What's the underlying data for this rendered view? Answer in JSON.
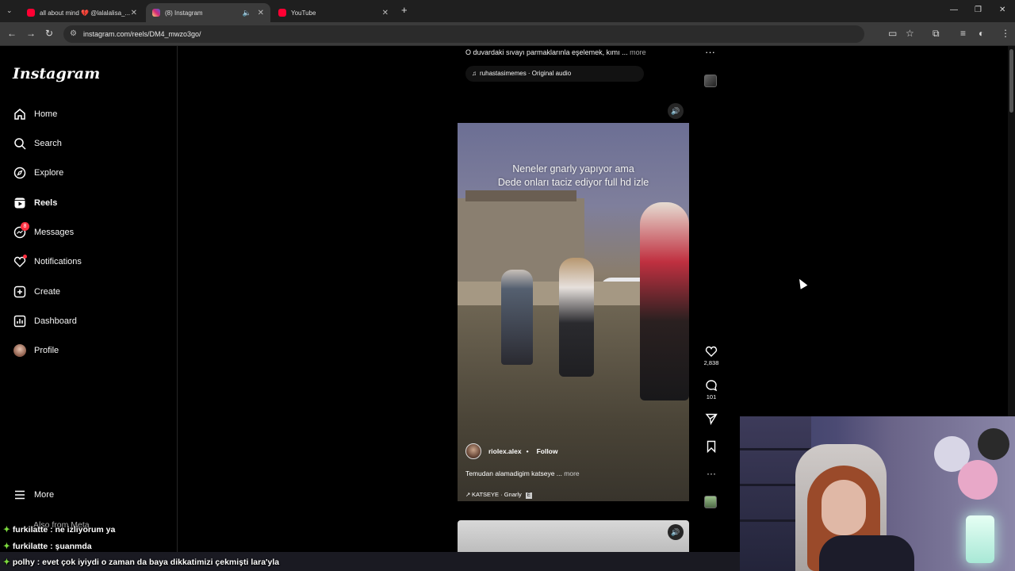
{
  "browser": {
    "tabs": [
      {
        "label": "all about mind 💔 @lalalalisa_...",
        "active": false,
        "favicon_color": "#ff0033"
      },
      {
        "label": "(8) Instagram",
        "active": true,
        "favicon_color": "#d62976"
      },
      {
        "label": "YouTube",
        "active": false,
        "favicon_color": "#ff0033"
      }
    ],
    "new_tab": "+",
    "url": "instagram.com/reels/DM4_mwzo3go/"
  },
  "sidebar": {
    "logo": "Instagram",
    "items": [
      {
        "label": "Home",
        "icon": "home-icon"
      },
      {
        "label": "Search",
        "icon": "search-icon"
      },
      {
        "label": "Explore",
        "icon": "compass-icon"
      },
      {
        "label": "Reels",
        "icon": "reels-icon",
        "active": true
      },
      {
        "label": "Messages",
        "icon": "messenger-icon",
        "badge": "8"
      },
      {
        "label": "Notifications",
        "icon": "heart-icon",
        "dot": true
      },
      {
        "label": "Create",
        "icon": "plus-square-icon"
      },
      {
        "label": "Dashboard",
        "icon": "chart-icon"
      },
      {
        "label": "Profile",
        "icon": "avatar"
      }
    ],
    "more": "More",
    "also_from_meta": "Also from Meta"
  },
  "feed": {
    "prev_caption": "O duvardaki sıvayı parmaklarınla eşelemek, kımı ...",
    "prev_more": "more",
    "prev_audio": "ruhastasimemes · Original audio",
    "reel": {
      "overlay_text_line1": "Neneler gnarly yapıyor ama",
      "overlay_text_line2": "Dede onları taciz ediyor full hd izle",
      "username": "riolex.alex",
      "separator": "•",
      "follow": "Follow",
      "caption": "Temudan alamadigim katseye ...",
      "caption_more": "more",
      "audio": "KATSEYE · Gnarly",
      "likes": "2,838",
      "comments": "101"
    }
  },
  "chat": [
    {
      "user": "furkilatte",
      "message": ": ne izliyorum ya"
    },
    {
      "user": "furkilatte",
      "message": ": şuanmda"
    },
    {
      "user": "polhy",
      "message": ": evet çok iyiydi o zaman da baya dikkatimizi çekmişti lara'yla"
    }
  ],
  "colors": {
    "accent_red": "#ff3040",
    "chat_gem": "#7ddc3e"
  }
}
